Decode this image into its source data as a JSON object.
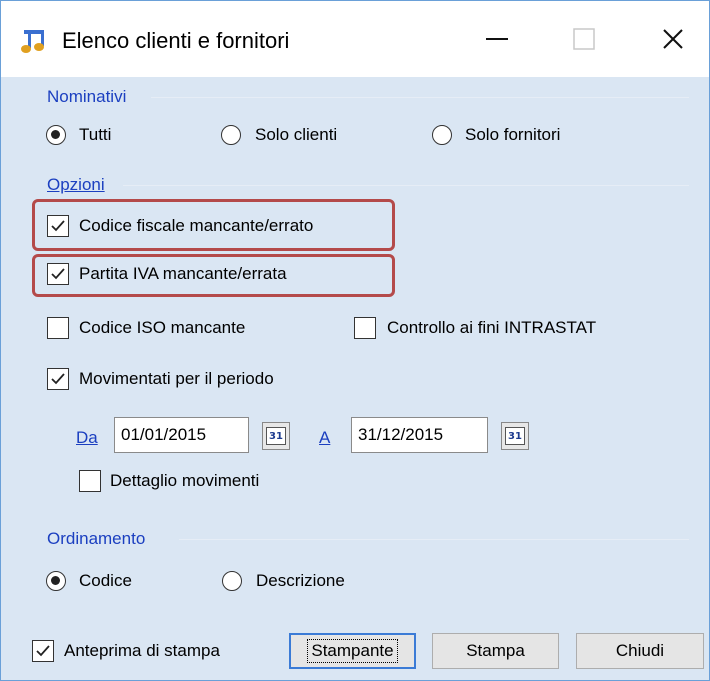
{
  "window": {
    "title": "Elenco clienti e fornitori"
  },
  "nominativi": {
    "label": "Nominativi",
    "options": [
      "Tutti",
      "Solo clienti",
      "Solo fornitori"
    ],
    "selected": "Tutti"
  },
  "opzioni": {
    "label": "Opzioni",
    "codice_fiscale": {
      "label": "Codice fiscale mancante/errato",
      "checked": true
    },
    "partita_iva": {
      "label": "Partita IVA mancante/errata",
      "checked": true
    },
    "codice_iso": {
      "label": "Codice ISO mancante",
      "checked": false
    },
    "intrastat": {
      "label": "Controllo ai fini INTRASTAT",
      "checked": false
    },
    "movimentati": {
      "label": "Movimentati per il periodo",
      "checked": true
    },
    "da_label": "Da",
    "da_value": "01/01/2015",
    "a_label": "A",
    "a_value": "31/12/2015",
    "calendar_icon_text": "31",
    "dettaglio": {
      "label": "Dettaglio movimenti",
      "checked": false
    }
  },
  "ordinamento": {
    "label": "Ordinamento",
    "options": [
      "Codice",
      "Descrizione"
    ],
    "selected": "Codice"
  },
  "footer": {
    "anteprima": {
      "label": "Anteprima di stampa",
      "checked": true
    },
    "stampante_label": "Stampante",
    "stampa_label": "Stampa",
    "chiudi_label": "Chiudi"
  },
  "colors": {
    "accent": "#1b3fc0",
    "highlight": "#b44a4a",
    "window_bg": "#dae6f3"
  }
}
